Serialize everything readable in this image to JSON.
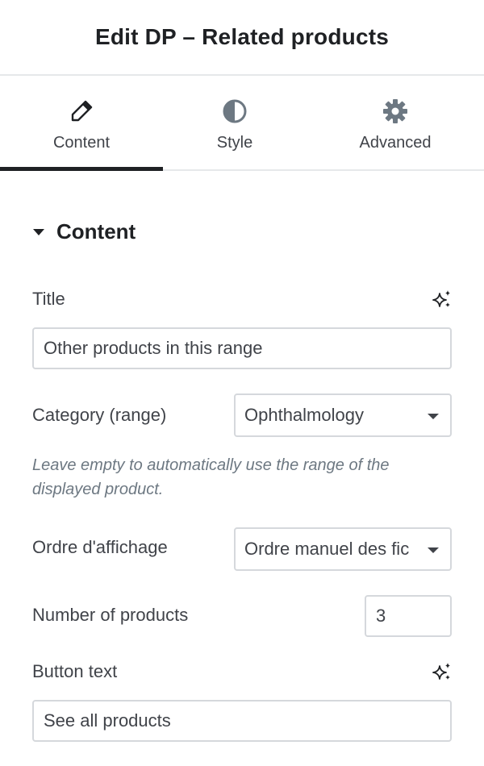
{
  "panel": {
    "title": "Edit DP – Related products"
  },
  "tabs": [
    {
      "label": "Content",
      "icon": "pencil-icon",
      "active": true
    },
    {
      "label": "Style",
      "icon": "contrast-icon",
      "active": false
    },
    {
      "label": "Advanced",
      "icon": "gear-icon",
      "active": false
    }
  ],
  "section": {
    "title": "Content",
    "icon": "caret-down-icon"
  },
  "fields": {
    "title": {
      "label": "Title",
      "value": "Other products in this range",
      "ai_icon": "sparkle-icon"
    },
    "category": {
      "label": "Category (range)",
      "value": "Ophthalmology",
      "hint": "Leave empty to automatically use the range of the displayed product."
    },
    "order": {
      "label": "Ordre d'affichage",
      "value": "Ordre manuel des fic"
    },
    "count": {
      "label": "Number of products",
      "value": "3"
    },
    "button_text": {
      "label": "Button text",
      "value": "See all products",
      "ai_icon": "sparkle-icon"
    }
  },
  "colors": {
    "text": "#1f2124",
    "muted": "#6d7882",
    "border": "#d5d8dc"
  }
}
